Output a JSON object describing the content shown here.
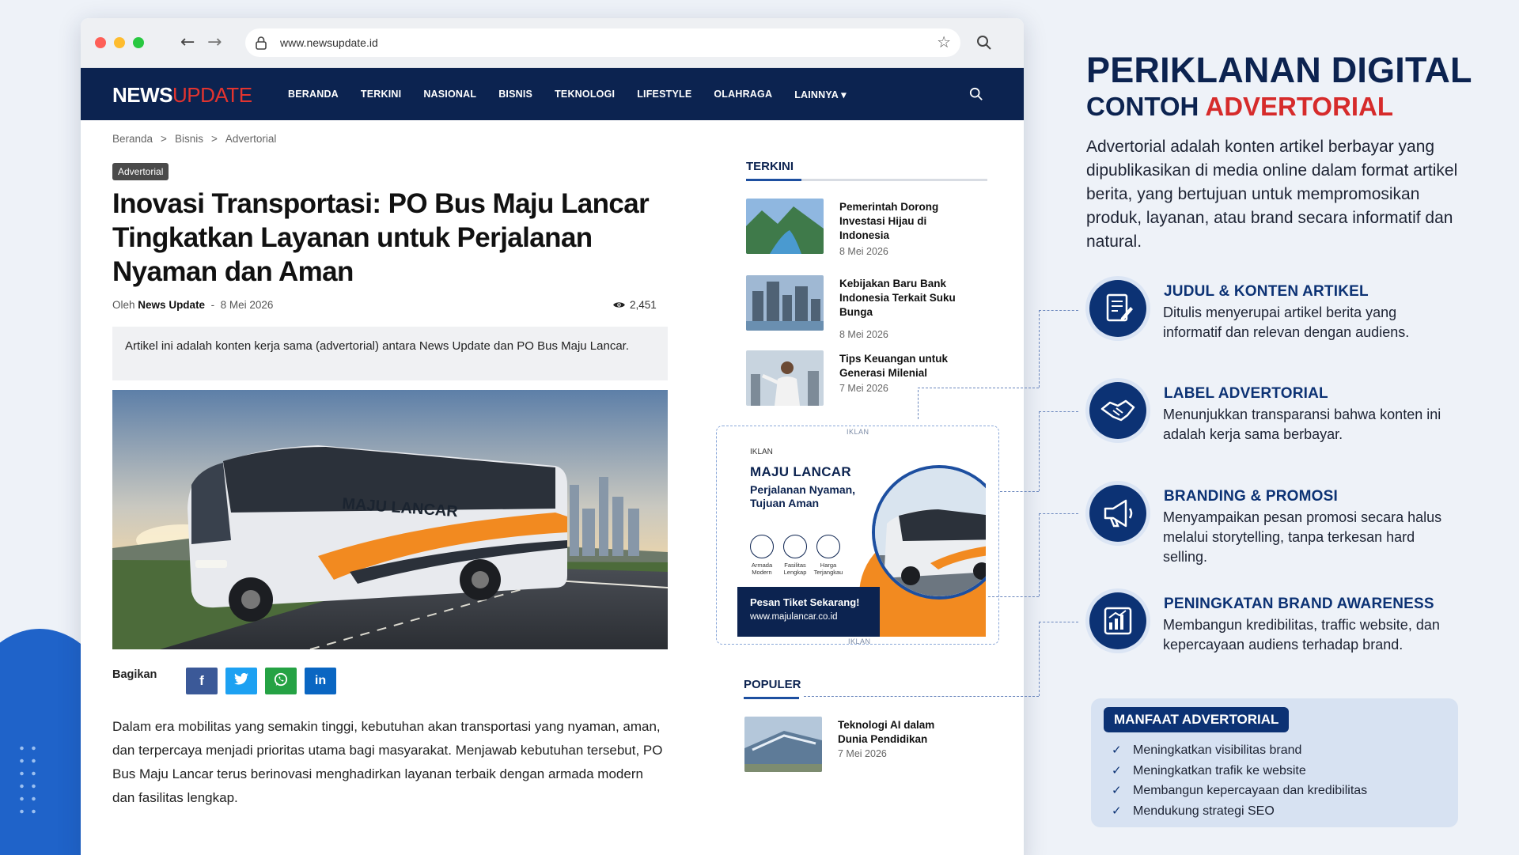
{
  "browser": {
    "url": "www.newsupdate.id"
  },
  "site": {
    "logo_part1": "NEWS",
    "logo_part2": "UPDATE",
    "menu": [
      "BERANDA",
      "TERKINI",
      "NASIONAL",
      "BISNIS",
      "TEKNOLOGI",
      "LIFESTYLE",
      "OLAHRAGA",
      "LAINNYA ▾"
    ]
  },
  "article": {
    "breadcrumb": [
      "Beranda",
      "Bisnis",
      "Advertorial"
    ],
    "badge": "Advertorial",
    "title": "Inovasi Transportasi: PO Bus Maju Lancar Tingkatkan Layanan untuk Perjalanan Nyaman dan Aman",
    "by_prefix": "Oleh",
    "author": "News Update",
    "date_sep": "-",
    "date": "8 Mei 2026",
    "views": "2,451",
    "disclaimer": "Artikel ini adalah konten kerja sama (advertorial) antara News Update dan PO Bus Maju Lancar.",
    "bus_label": "MAJU LANCAR",
    "share_label": "Bagikan",
    "share_buttons": [
      "f",
      "t",
      "w",
      "in"
    ],
    "body": "Dalam era mobilitas yang semakin tinggi, kebutuhan akan transportasi yang nyaman, aman, dan terpercaya menjadi prioritas utama bagi masyarakat. Menjawab kebutuhan tersebut, PO Bus Maju Lancar terus berinovasi menghadirkan layanan terbaik dengan armada modern dan fasilitas lengkap."
  },
  "sidebar": {
    "latest_heading": "TERKINI",
    "latest": [
      {
        "title": "Pemerintah Dorong Investasi Hijau di Indonesia",
        "date": "8 Mei 2026"
      },
      {
        "title": "Kebijakan Baru Bank Indonesia Terkait Suku Bunga",
        "date": "8 Mei 2026"
      },
      {
        "title": "Tips Keuangan untuk Generasi Milenial",
        "date": "7 Mei 2026"
      }
    ],
    "ad": {
      "frame_label": "IKLAN",
      "caption": "IKLAN",
      "brand": "MAJU LANCAR",
      "tagline": "Perjalanan Nyaman, Tujuan Aman",
      "features": [
        "Armada Modern",
        "Fasilitas Lengkap",
        "Harga Terjangkau"
      ],
      "cta": "Pesan Tiket Sekarang!",
      "website": "www.majulancar.co.id"
    },
    "popular_heading": "POPULER",
    "popular": [
      {
        "title": "Teknologi AI dalam Dunia Pendidikan",
        "date": "7 Mei 2026"
      }
    ]
  },
  "infographic": {
    "title": "PERIKLANAN DIGITAL",
    "subtitle_part1": "CONTOH",
    "subtitle_part2": "ADVERTORIAL",
    "description": "Advertorial adalah konten artikel berbayar yang dipublikasikan di media online dalam format artikel berita, yang bertujuan untuk mempromosikan produk, layanan, atau brand secara informatif dan natural.",
    "features": [
      {
        "title": "JUDUL & KONTEN ARTIKEL",
        "desc": "Ditulis menyerupai artikel berita yang informatif dan relevan dengan audiens.",
        "icon": "document-edit-icon"
      },
      {
        "title": "LABEL ADVERTORIAL",
        "desc": "Menunjukkan transparansi bahwa konten ini adalah kerja sama berbayar.",
        "icon": "handshake-icon"
      },
      {
        "title": "BRANDING & PROMOSI",
        "desc": "Menyampaikan pesan promosi secara halus melalui storytelling, tanpa terkesan hard selling.",
        "icon": "megaphone-icon"
      },
      {
        "title": "PENINGKATAN BRAND AWARENESS",
        "desc": "Membangun kredibilitas, traffic website, dan kepercayaan audiens terhadap brand.",
        "icon": "growth-chart-icon"
      }
    ],
    "benefits_heading": "MANFAAT ADVERTORIAL",
    "benefits": [
      "Meningkatkan visibilitas brand",
      "Meningkatkan trafik ke website",
      "Membangun kepercayaan dan kredibilitas",
      "Mendukung strategi SEO"
    ]
  },
  "colors": {
    "navy": "#0c2350",
    "accent_red": "#d62b2b",
    "orange": "#f28a20"
  }
}
